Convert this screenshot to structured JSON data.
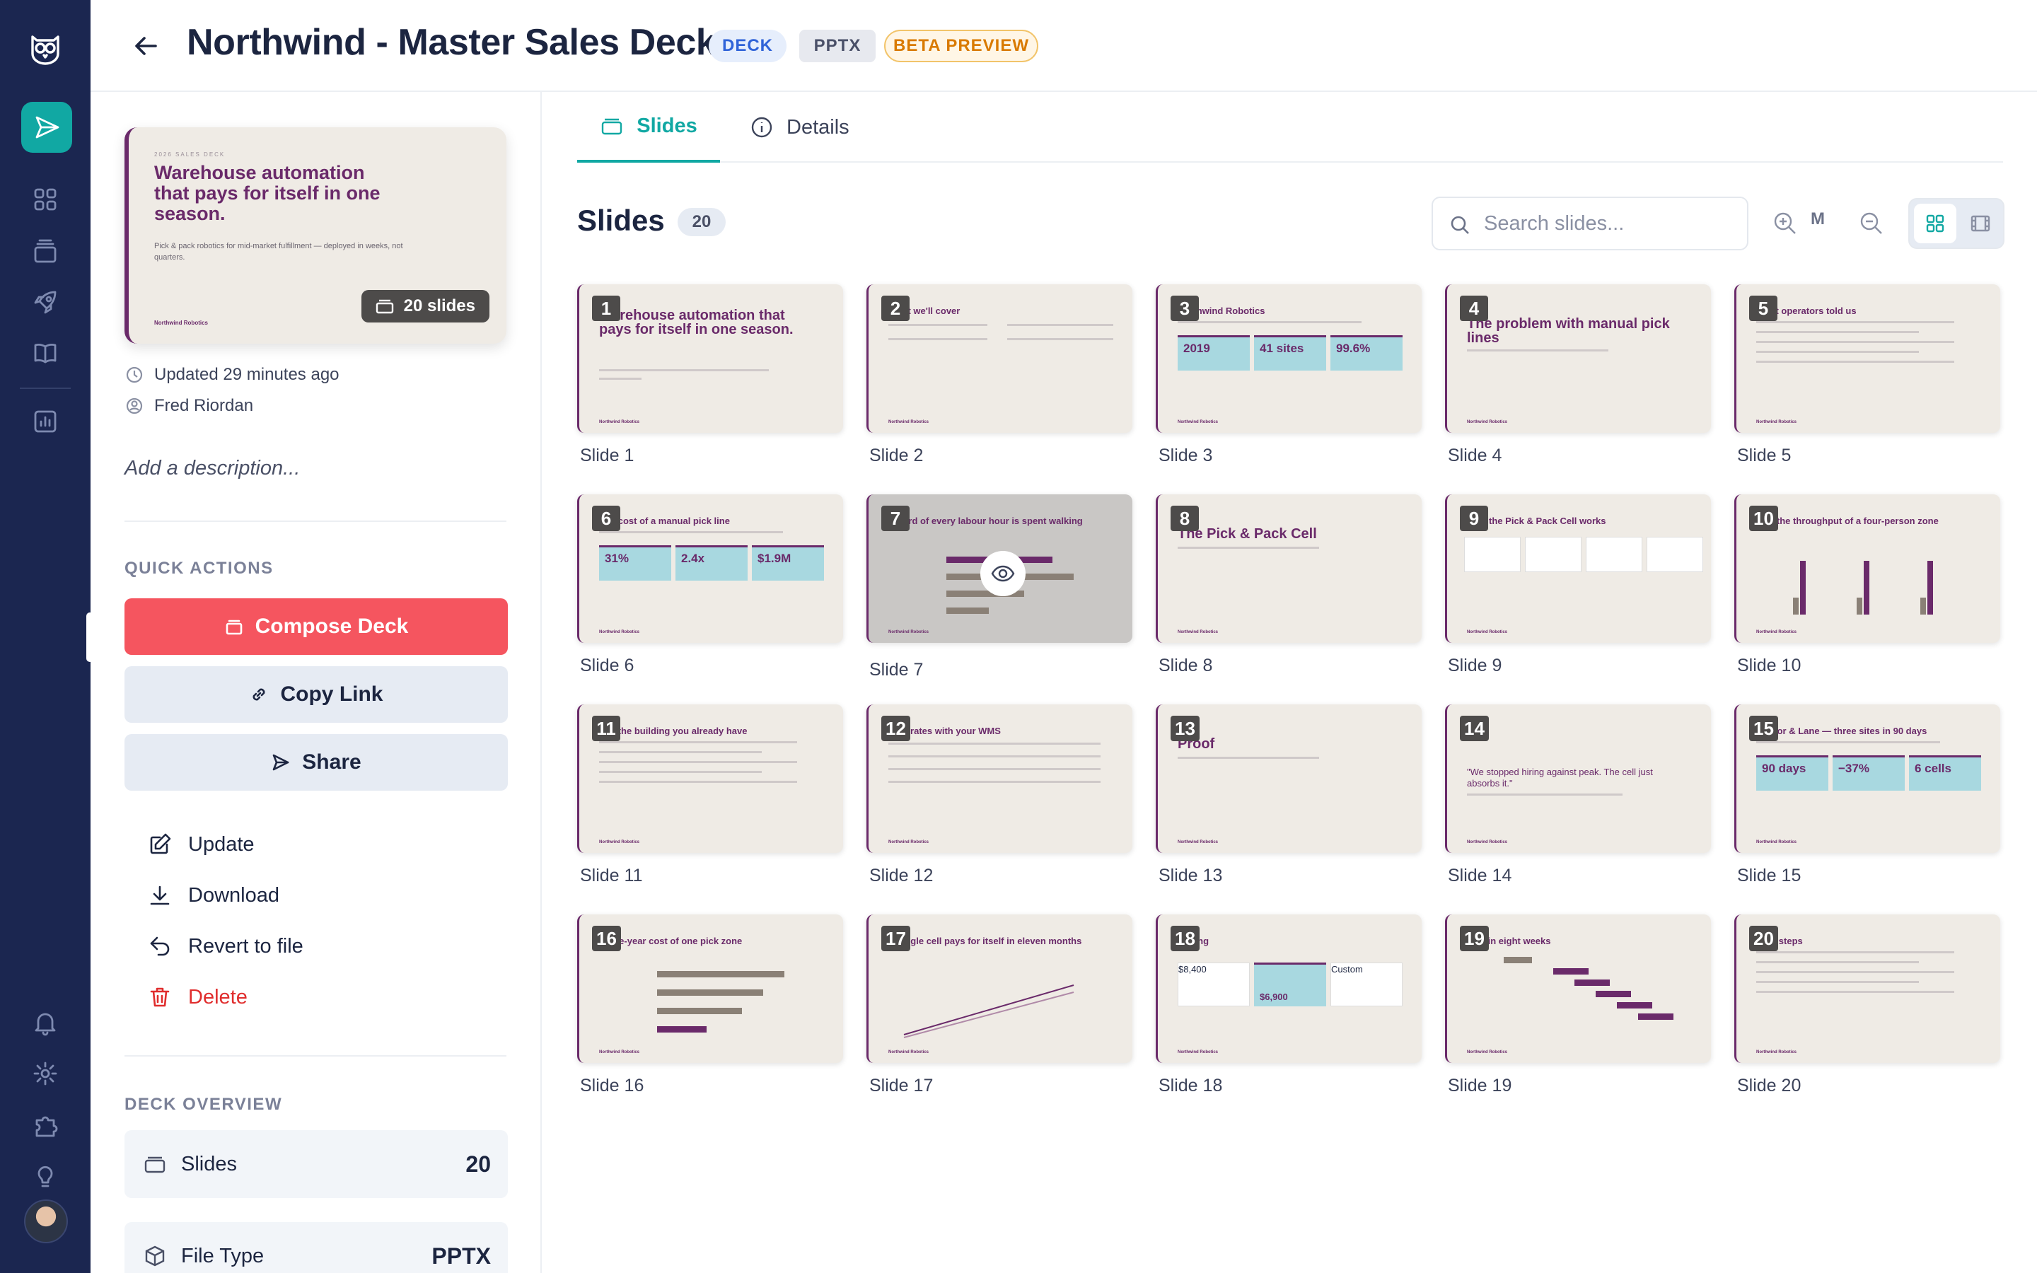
{
  "deck": {
    "title": "Northwind - Master Sales Deck",
    "badges": [
      "DECK",
      "PPTX",
      "BETA PREVIEW"
    ]
  },
  "cover": {
    "kicker": "2026 SALES DECK",
    "headline": "Warehouse automation that pays for itself in one season.",
    "subtitle": "Pick & pack robotics for mid-market fulfillment — deployed in weeks, not quarters.",
    "footer": "Northwind Robotics",
    "slide_count_label": "20 slides"
  },
  "meta": {
    "updated": "Updated 29 minutes ago",
    "author": "Fred Riordan",
    "description_placeholder": "Add a description..."
  },
  "quick_actions": {
    "heading": "QUICK ACTIONS",
    "compose": "Compose Deck",
    "copy_link": "Copy Link",
    "share": "Share",
    "update": "Update",
    "download": "Download",
    "revert": "Revert to file",
    "delete": "Delete"
  },
  "overview": {
    "heading": "DECK OVERVIEW",
    "slides_label": "Slides",
    "slides_value": "20",
    "filetype_label": "File Type",
    "filetype_value": "PPTX"
  },
  "tabs": [
    {
      "label": "Slides",
      "active": true
    },
    {
      "label": "Details",
      "active": false
    }
  ],
  "slides_panel": {
    "title": "Slides",
    "count": "20",
    "search_placeholder": "Search slides...",
    "zoom_level": "M"
  },
  "slides": [
    {
      "n": "1",
      "label": "Slide 1",
      "title": "Warehouse automation that pays for itself in one season.",
      "kind": "cover"
    },
    {
      "n": "2",
      "label": "Slide 2",
      "title": "What we'll cover",
      "kind": "list2"
    },
    {
      "n": "3",
      "label": "Slide 3",
      "title": "Northwind Robotics",
      "kind": "stats",
      "stats": [
        "2019",
        "41 sites",
        "99.6%"
      ]
    },
    {
      "n": "4",
      "label": "Slide 4",
      "title": "The problem with manual pick lines",
      "kind": "big"
    },
    {
      "n": "5",
      "label": "Slide 5",
      "title": "What operators told us",
      "kind": "bullets"
    },
    {
      "n": "6",
      "label": "Slide 6",
      "title": "The cost of a manual pick line",
      "kind": "stats",
      "stats": [
        "31%",
        "2.4x",
        "$1.9M"
      ]
    },
    {
      "n": "7",
      "label": "Slide 7",
      "title": "A third of every labour hour is spent walking",
      "kind": "hbar",
      "hover": true
    },
    {
      "n": "8",
      "label": "Slide 8",
      "title": "The Pick & Pack Cell",
      "kind": "big"
    },
    {
      "n": "9",
      "label": "Slide 9",
      "title": "How the Pick & Pack Cell works",
      "kind": "steps"
    },
    {
      "n": "10",
      "label": "Slide 10",
      "title": "2.7x the throughput of a four-person zone",
      "kind": "vbar"
    },
    {
      "n": "11",
      "label": "Slide 11",
      "title": "Fits the building you already have",
      "kind": "bullets"
    },
    {
      "n": "12",
      "label": "Slide 12",
      "title": "Integrates with your WMS",
      "kind": "table"
    },
    {
      "n": "13",
      "label": "Slide 13",
      "title": "Proof",
      "kind": "big"
    },
    {
      "n": "14",
      "label": "Slide 14",
      "title": "\"We stopped hiring against peak. The cell just absorbs it.\"",
      "kind": "quote"
    },
    {
      "n": "15",
      "label": "Slide 15",
      "title": "Harbor & Lane — three sites in 90 days",
      "kind": "stats",
      "stats": [
        "90 days",
        "−37%",
        "6 cells"
      ]
    },
    {
      "n": "16",
      "label": "Slide 16",
      "title": "Three-year cost of one pick zone",
      "kind": "hbar2"
    },
    {
      "n": "17",
      "label": "Slide 17",
      "title": "A single cell pays for itself in eleven months",
      "kind": "line"
    },
    {
      "n": "18",
      "label": "Slide 18",
      "title": "Pricing",
      "kind": "pricing",
      "stats": [
        "$8,400",
        "$6,900",
        "Custom"
      ]
    },
    {
      "n": "19",
      "label": "Slide 19",
      "title": "Live in eight weeks",
      "kind": "gantt"
    },
    {
      "n": "20",
      "label": "Slide 20",
      "title": "Next steps",
      "kind": "bullets"
    }
  ],
  "colors": {
    "rail": "#1b2650",
    "accent": "#11a8a3",
    "danger": "#f5555f",
    "slide_plum": "#6a2a6a",
    "slide_bg": "#efebe5"
  }
}
